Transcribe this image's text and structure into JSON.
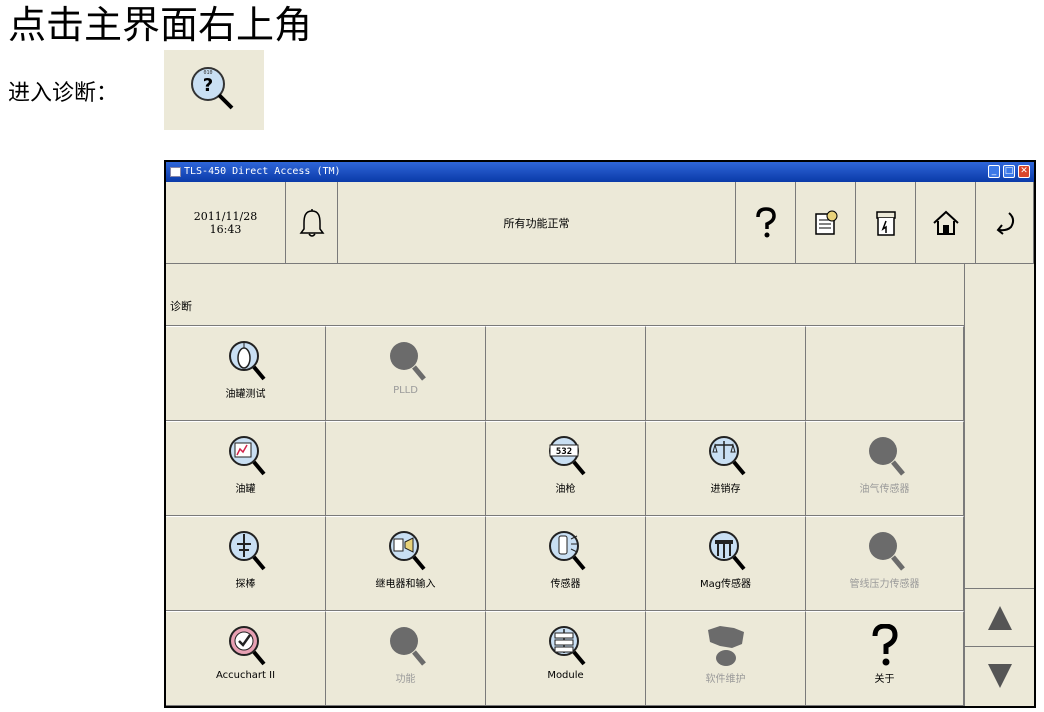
{
  "doc": {
    "heading": "点击主界面右上角",
    "instruction": "进入诊断："
  },
  "window": {
    "title": "TLS-450 Direct Access (TM)",
    "controls": {
      "minimize": "_",
      "maximize": "□",
      "close": "✕"
    }
  },
  "toolbar": {
    "date": "2011/11/28",
    "time": "16:43",
    "status": "所有功能正常",
    "icons": [
      "bell-icon",
      "help-icon",
      "diagnostics-icon",
      "report-icon",
      "home-icon",
      "back-icon"
    ]
  },
  "section": {
    "label": "诊断"
  },
  "grid": {
    "rows": [
      [
        {
          "label": "油罐测试",
          "icon": "tank-test-icon",
          "enabled": true
        },
        {
          "label": "PLLD",
          "icon": "magnifier-icon",
          "enabled": false
        },
        {
          "label": "",
          "icon": "",
          "enabled": false
        },
        {
          "label": "",
          "icon": "",
          "enabled": false
        },
        {
          "label": "",
          "icon": "",
          "enabled": false
        }
      ],
      [
        {
          "label": "油罐",
          "icon": "tank-chart-icon",
          "enabled": true
        },
        {
          "label": "",
          "icon": "",
          "enabled": false
        },
        {
          "label": "油枪",
          "icon": "nozzle-counter-icon",
          "counter": "532",
          "enabled": true
        },
        {
          "label": "进销存",
          "icon": "balance-scale-icon",
          "enabled": true
        },
        {
          "label": "油气传感器",
          "icon": "magnifier-icon",
          "enabled": false
        }
      ],
      [
        {
          "label": "探棒",
          "icon": "probe-icon",
          "enabled": true
        },
        {
          "label": "继电器和输入",
          "icon": "relay-icon",
          "enabled": true
        },
        {
          "label": "传感器",
          "icon": "sensor-icon",
          "enabled": true
        },
        {
          "label": "Mag传感器",
          "icon": "mag-sensor-icon",
          "enabled": true
        },
        {
          "label": "管线压力传感器",
          "icon": "magnifier-icon",
          "enabled": false
        }
      ],
      [
        {
          "label": "Accuchart II",
          "icon": "accuchart-icon",
          "enabled": true
        },
        {
          "label": "功能",
          "icon": "magnifier-icon",
          "enabled": false
        },
        {
          "label": "Module",
          "icon": "module-icon",
          "enabled": true
        },
        {
          "label": "软件维护",
          "icon": "software-maintenance-icon",
          "enabled": false
        },
        {
          "label": "关于",
          "icon": "about-icon",
          "enabled": true
        }
      ]
    ]
  },
  "scroll": {
    "up": "scroll-up-icon",
    "down": "scroll-down-icon"
  },
  "colors": {
    "panel": "#ece9d8",
    "titlebar": "#0a3aa8",
    "disabled_text": "#9a9a9a",
    "grid_line": "#7a7a7a"
  }
}
